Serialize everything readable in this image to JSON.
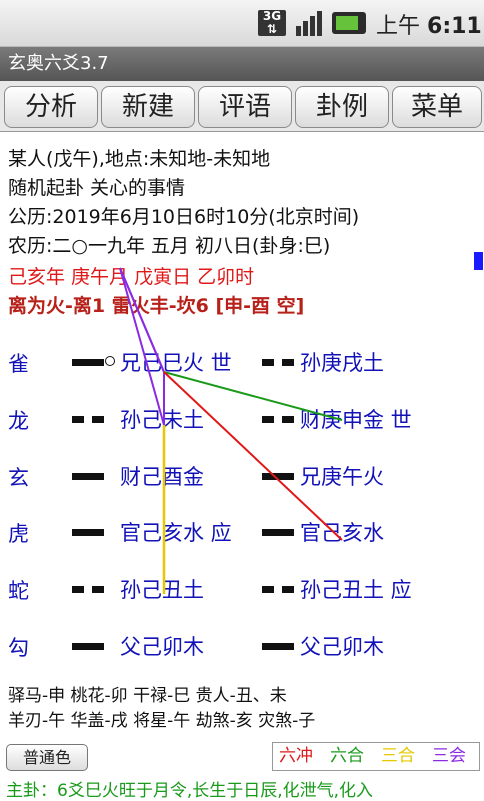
{
  "status_bar": {
    "network": "3G",
    "time_prefix": "上午",
    "time": "6:11"
  },
  "window": {
    "title": "玄奥六爻3.7"
  },
  "tabs": [
    {
      "label": "分析"
    },
    {
      "label": "新建"
    },
    {
      "label": "评语"
    },
    {
      "label": "卦例"
    },
    {
      "label": "菜单"
    }
  ],
  "info": {
    "person": "某人(戊午),地点:未知地-未知地",
    "method": "随机起卦  关心的事情",
    "gregorian": "公历:2019年6月10日6时10分(北京时间)",
    "lunar": "农历:二○一九年 五月 初八日(卦身:巳)",
    "ganzhi": "己亥年   庚午月   戊寅日   乙卯时",
    "gua": "离为火-离1  雷火丰-坎6 [申-酉 空]"
  },
  "lines": [
    {
      "god": "雀",
      "main": "兄己巳火 世",
      "changed": "孙庚戌土",
      "main_yang": true,
      "changed_yang": false,
      "moving": true
    },
    {
      "god": "龙",
      "main": "孙己未土",
      "changed": "财庚申金 世",
      "main_yang": false,
      "changed_yang": false,
      "moving": false
    },
    {
      "god": "玄",
      "main": "财己酉金",
      "changed": "兄庚午火",
      "main_yang": true,
      "changed_yang": true,
      "moving": false
    },
    {
      "god": "虎",
      "main": "官己亥水 应",
      "changed": "官己亥水",
      "main_yang": true,
      "changed_yang": true,
      "moving": false
    },
    {
      "god": "蛇",
      "main": "孙己丑土",
      "changed": "孙己丑土 应",
      "main_yang": false,
      "changed_yang": false,
      "moving": false
    },
    {
      "god": "勾",
      "main": "父己卯木",
      "changed": "父己卯木",
      "main_yang": true,
      "changed_yang": true,
      "moving": false
    }
  ],
  "shensha": {
    "row1": "驿马-申    桃花-卯    干禄-巳    贵人-丑、未",
    "row2": "羊刃-午    华盖-戌    将星-午    劫煞-亥    灾煞-子"
  },
  "footer": {
    "color_button": "普通色",
    "legend": {
      "chong": "六冲",
      "he": "六合",
      "sanhe": "三合",
      "sanhui": "三会"
    },
    "legend_colors": {
      "chong": "#e01818",
      "he": "#1a9a1a",
      "sanhe": "#e6c800",
      "sanhui": "#8a2be2"
    },
    "summary": "主卦：6爻巳火旺于月令,长生于日辰,化泄气,化入"
  }
}
